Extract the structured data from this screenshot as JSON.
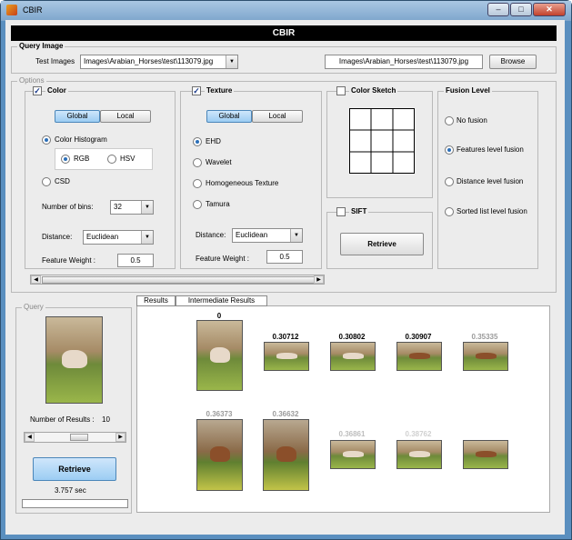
{
  "window": {
    "title": "CBIR",
    "min": "–",
    "max": "□",
    "close": "✕"
  },
  "header": {
    "title": "CBIR"
  },
  "query_image": {
    "group_title": "Query Image",
    "test_images_label": "Test Images",
    "select_value": "Images\\Arabian_Horses\\test\\113079.jpg",
    "path_display": "Images\\Arabian_Horses\\test\\113079.jpg",
    "browse_label": "Browse"
  },
  "options": {
    "group_title": "Options",
    "color": {
      "title": "Color",
      "checked": "✓",
      "global_label": "Global",
      "local_label": "Local",
      "color_histogram_label": "Color Histogram",
      "rgb_label": "RGB",
      "hsv_label": "HSV",
      "csd_label": "CSD",
      "bins_label": "Number of bins:",
      "bins_value": "32",
      "distance_label": "Distance:",
      "distance_value": "Euclidean",
      "weight_label": "Feature Weight :",
      "weight_value": "0.5"
    },
    "texture": {
      "title": "Texture",
      "checked": "✓",
      "global_label": "Global",
      "local_label": "Local",
      "ehd_label": "EHD",
      "wavelet_label": "Wavelet",
      "homogeneous_label": "Homogeneous Texture",
      "tamura_label": "Tamura",
      "distance_label": "Distance:",
      "distance_value": "Euclidean",
      "weight_label": "Feature Weight :",
      "weight_value": "0.5"
    },
    "color_sketch": {
      "title": "Color Sketch"
    },
    "sift": {
      "title": "SIFT",
      "retrieve_label": "Retrieve"
    },
    "fusion": {
      "title": "Fusion Level",
      "no_fusion": "No fusion",
      "features_level": "Features level fusion",
      "distance_level": "Distance level fusion",
      "sorted_list": "Sorted list level fusion",
      "selected": "Features level fusion"
    }
  },
  "query": {
    "group_title": "Query",
    "results_label": "Number of Results :",
    "results_value": "10",
    "retrieve_label": "Retrieve",
    "time": "3.757 sec"
  },
  "results": {
    "tabs": [
      "Results",
      "Intermediate Results"
    ],
    "scores": [
      "0",
      "0.30712",
      "0.30802",
      "0.30907",
      "0.35335",
      "0.36373",
      "0.36632",
      "0.36861",
      "0.38762",
      ""
    ]
  },
  "colors": {
    "accent": "#2c6fb8",
    "header_bg": "#000000",
    "selected_button": "#9ccdf3"
  },
  "icons": [
    "app-icon",
    "minimize-icon",
    "maximize-icon",
    "close-icon",
    "dropdown-arrow-icon",
    "scroll-left-icon",
    "scroll-right-icon"
  ]
}
